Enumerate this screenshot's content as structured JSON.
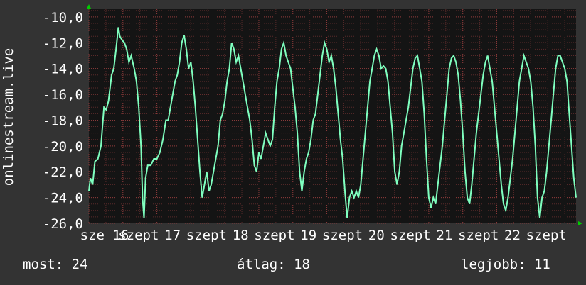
{
  "colors": {
    "background": "#333333",
    "plot_background": "#141414",
    "grid_minor": "#5a2a2a",
    "grid_major": "#8a3a3a",
    "line": "#7fffbf",
    "arrow": "#00cc00",
    "text": "#ffffff"
  },
  "stats": {
    "now": "most: 24",
    "avg": "átlag: 18",
    "max": "legjobb: 11"
  },
  "chart_data": {
    "type": "line",
    "title": "",
    "xlabel": "",
    "ylabel": "onlinestream.live",
    "ylim": [
      -26,
      -9.4
    ],
    "yticks": [
      -10,
      -12,
      -14,
      -16,
      -18,
      -20,
      -22,
      -24,
      -26
    ],
    "ytick_labels": [
      "-10,0",
      "-12,0",
      "-14,0",
      "-16,0",
      "-18,0",
      "-20,0",
      "-22,0",
      "-24,0",
      "-26,0"
    ],
    "xlim": [
      0,
      6.45
    ],
    "xtick_labels": [
      {
        "x": 0.0,
        "label": "sze 16"
      },
      {
        "x": 0.45,
        "label": "szept"
      },
      {
        "x": 0.9,
        "label": "17"
      },
      {
        "x": 1.35,
        "label": "szept"
      },
      {
        "x": 1.8,
        "label": "18"
      },
      {
        "x": 2.25,
        "label": "szept"
      },
      {
        "x": 2.7,
        "label": "19"
      },
      {
        "x": 3.15,
        "label": "szept"
      },
      {
        "x": 3.6,
        "label": "20"
      },
      {
        "x": 4.05,
        "label": "szept"
      },
      {
        "x": 4.5,
        "label": "21"
      },
      {
        "x": 4.95,
        "label": "szept"
      },
      {
        "x": 5.4,
        "label": "22"
      },
      {
        "x": 5.85,
        "label": "szept"
      }
    ],
    "grid": true,
    "series": [
      {
        "points": [
          [
            0.0,
            -23.5
          ],
          [
            0.02,
            -22.5
          ],
          [
            0.05,
            -23.0
          ],
          [
            0.08,
            -21.2
          ],
          [
            0.12,
            -21.0
          ],
          [
            0.16,
            -20.0
          ],
          [
            0.2,
            -17.0
          ],
          [
            0.23,
            -17.2
          ],
          [
            0.26,
            -16.5
          ],
          [
            0.3,
            -14.5
          ],
          [
            0.33,
            -14.0
          ],
          [
            0.36,
            -12.5
          ],
          [
            0.39,
            -10.8
          ],
          [
            0.41,
            -11.5
          ],
          [
            0.44,
            -11.8
          ],
          [
            0.47,
            -12.0
          ],
          [
            0.5,
            -12.5
          ],
          [
            0.53,
            -13.5
          ],
          [
            0.56,
            -13.0
          ],
          [
            0.6,
            -14.0
          ],
          [
            0.63,
            -15.0
          ],
          [
            0.66,
            -17.0
          ],
          [
            0.69,
            -20.0
          ],
          [
            0.71,
            -24.0
          ],
          [
            0.73,
            -25.6
          ],
          [
            0.75,
            -22.5
          ],
          [
            0.78,
            -21.5
          ],
          [
            0.82,
            -21.5
          ],
          [
            0.86,
            -21.0
          ],
          [
            0.9,
            -21.0
          ],
          [
            0.94,
            -20.5
          ],
          [
            0.98,
            -19.5
          ],
          [
            1.02,
            -18.0
          ],
          [
            1.05,
            -18.0
          ],
          [
            1.08,
            -17.0
          ],
          [
            1.11,
            -16.0
          ],
          [
            1.14,
            -15.0
          ],
          [
            1.17,
            -14.5
          ],
          [
            1.2,
            -13.5
          ],
          [
            1.23,
            -12.0
          ],
          [
            1.26,
            -11.4
          ],
          [
            1.29,
            -12.5
          ],
          [
            1.32,
            -14.0
          ],
          [
            1.35,
            -13.5
          ],
          [
            1.38,
            -15.0
          ],
          [
            1.41,
            -17.0
          ],
          [
            1.44,
            -19.5
          ],
          [
            1.47,
            -22.0
          ],
          [
            1.5,
            -24.0
          ],
          [
            1.53,
            -23.0
          ],
          [
            1.56,
            -22.0
          ],
          [
            1.59,
            -23.5
          ],
          [
            1.62,
            -23.0
          ],
          [
            1.65,
            -22.0
          ],
          [
            1.68,
            -21.0
          ],
          [
            1.71,
            -20.0
          ],
          [
            1.74,
            -18.0
          ],
          [
            1.77,
            -17.5
          ],
          [
            1.8,
            -16.5
          ],
          [
            1.83,
            -15.0
          ],
          [
            1.86,
            -14.0
          ],
          [
            1.89,
            -12.0
          ],
          [
            1.92,
            -12.5
          ],
          [
            1.95,
            -13.5
          ],
          [
            1.98,
            -13.0
          ],
          [
            2.01,
            -14.0
          ],
          [
            2.04,
            -15.0
          ],
          [
            2.07,
            -16.0
          ],
          [
            2.1,
            -17.0
          ],
          [
            2.13,
            -18.0
          ],
          [
            2.16,
            -19.5
          ],
          [
            2.19,
            -21.5
          ],
          [
            2.22,
            -22.0
          ],
          [
            2.25,
            -20.5
          ],
          [
            2.28,
            -21.0
          ],
          [
            2.31,
            -20.0
          ],
          [
            2.34,
            -19.0
          ],
          [
            2.37,
            -19.5
          ],
          [
            2.4,
            -20.0
          ],
          [
            2.43,
            -19.5
          ],
          [
            2.46,
            -17.0
          ],
          [
            2.49,
            -15.0
          ],
          [
            2.52,
            -14.0
          ],
          [
            2.55,
            -12.5
          ],
          [
            2.58,
            -12.0
          ],
          [
            2.61,
            -13.0
          ],
          [
            2.64,
            -13.5
          ],
          [
            2.67,
            -14.0
          ],
          [
            2.7,
            -15.5
          ],
          [
            2.73,
            -17.0
          ],
          [
            2.76,
            -19.0
          ],
          [
            2.79,
            -22.0
          ],
          [
            2.82,
            -23.5
          ],
          [
            2.85,
            -22.0
          ],
          [
            2.88,
            -21.0
          ],
          [
            2.91,
            -20.5
          ],
          [
            2.94,
            -19.5
          ],
          [
            2.97,
            -18.0
          ],
          [
            3.0,
            -17.5
          ],
          [
            3.03,
            -16.0
          ],
          [
            3.06,
            -14.5
          ],
          [
            3.09,
            -13.0
          ],
          [
            3.12,
            -12.0
          ],
          [
            3.15,
            -12.5
          ],
          [
            3.18,
            -13.5
          ],
          [
            3.21,
            -13.0
          ],
          [
            3.24,
            -14.0
          ],
          [
            3.27,
            -15.5
          ],
          [
            3.3,
            -17.5
          ],
          [
            3.33,
            -19.5
          ],
          [
            3.36,
            -21.0
          ],
          [
            3.39,
            -23.5
          ],
          [
            3.42,
            -25.6
          ],
          [
            3.45,
            -24.0
          ],
          [
            3.48,
            -23.5
          ],
          [
            3.51,
            -24.0
          ],
          [
            3.54,
            -23.5
          ],
          [
            3.57,
            -24.0
          ],
          [
            3.6,
            -23.0
          ],
          [
            3.63,
            -21.0
          ],
          [
            3.66,
            -19.0
          ],
          [
            3.69,
            -17.0
          ],
          [
            3.72,
            -15.0
          ],
          [
            3.75,
            -14.0
          ],
          [
            3.78,
            -13.0
          ],
          [
            3.81,
            -12.5
          ],
          [
            3.84,
            -13.0
          ],
          [
            3.87,
            -14.0
          ],
          [
            3.9,
            -13.8
          ],
          [
            3.93,
            -14.0
          ],
          [
            3.96,
            -15.0
          ],
          [
            3.99,
            -17.0
          ],
          [
            4.02,
            -19.0
          ],
          [
            4.05,
            -22.0
          ],
          [
            4.08,
            -23.0
          ],
          [
            4.11,
            -22.0
          ],
          [
            4.14,
            -20.0
          ],
          [
            4.17,
            -19.0
          ],
          [
            4.2,
            -18.0
          ],
          [
            4.23,
            -17.0
          ],
          [
            4.26,
            -15.5
          ],
          [
            4.29,
            -14.0
          ],
          [
            4.32,
            -13.2
          ],
          [
            4.35,
            -13.0
          ],
          [
            4.38,
            -14.0
          ],
          [
            4.41,
            -15.0
          ],
          [
            4.44,
            -17.5
          ],
          [
            4.47,
            -21.0
          ],
          [
            4.5,
            -24.0
          ],
          [
            4.53,
            -24.8
          ],
          [
            4.56,
            -24.0
          ],
          [
            4.59,
            -24.5
          ],
          [
            4.62,
            -23.0
          ],
          [
            4.65,
            -21.5
          ],
          [
            4.68,
            -20.0
          ],
          [
            4.71,
            -18.0
          ],
          [
            4.74,
            -16.0
          ],
          [
            4.77,
            -14.0
          ],
          [
            4.8,
            -13.2
          ],
          [
            4.83,
            -13.0
          ],
          [
            4.86,
            -13.5
          ],
          [
            4.89,
            -14.5
          ],
          [
            4.92,
            -16.5
          ],
          [
            4.95,
            -19.0
          ],
          [
            4.98,
            -22.0
          ],
          [
            5.01,
            -24.0
          ],
          [
            5.04,
            -24.5
          ],
          [
            5.07,
            -23.0
          ],
          [
            5.1,
            -21.0
          ],
          [
            5.13,
            -19.0
          ],
          [
            5.16,
            -17.5
          ],
          [
            5.19,
            -16.0
          ],
          [
            5.22,
            -14.5
          ],
          [
            5.25,
            -13.5
          ],
          [
            5.28,
            -13.0
          ],
          [
            5.31,
            -14.0
          ],
          [
            5.34,
            -15.0
          ],
          [
            5.37,
            -17.0
          ],
          [
            5.4,
            -19.0
          ],
          [
            5.43,
            -21.0
          ],
          [
            5.46,
            -23.0
          ],
          [
            5.49,
            -24.5
          ],
          [
            5.52,
            -25.0
          ],
          [
            5.55,
            -24.0
          ],
          [
            5.58,
            -22.5
          ],
          [
            5.61,
            -21.0
          ],
          [
            5.64,
            -19.0
          ],
          [
            5.67,
            -17.0
          ],
          [
            5.7,
            -15.0
          ],
          [
            5.73,
            -14.0
          ],
          [
            5.76,
            -13.0
          ],
          [
            5.79,
            -13.5
          ],
          [
            5.82,
            -14.0
          ],
          [
            5.85,
            -15.0
          ],
          [
            5.88,
            -17.0
          ],
          [
            5.91,
            -20.0
          ],
          [
            5.94,
            -24.0
          ],
          [
            5.97,
            -25.6
          ],
          [
            6.0,
            -24.0
          ],
          [
            6.03,
            -23.5
          ],
          [
            6.06,
            -22.0
          ],
          [
            6.09,
            -20.0
          ],
          [
            6.12,
            -18.0
          ],
          [
            6.15,
            -16.0
          ],
          [
            6.18,
            -14.0
          ],
          [
            6.21,
            -13.0
          ],
          [
            6.24,
            -13.0
          ],
          [
            6.27,
            -13.5
          ],
          [
            6.3,
            -14.0
          ],
          [
            6.33,
            -15.0
          ],
          [
            6.36,
            -17.5
          ],
          [
            6.39,
            -20.0
          ],
          [
            6.42,
            -22.5
          ],
          [
            6.45,
            -24.0
          ]
        ]
      }
    ]
  }
}
